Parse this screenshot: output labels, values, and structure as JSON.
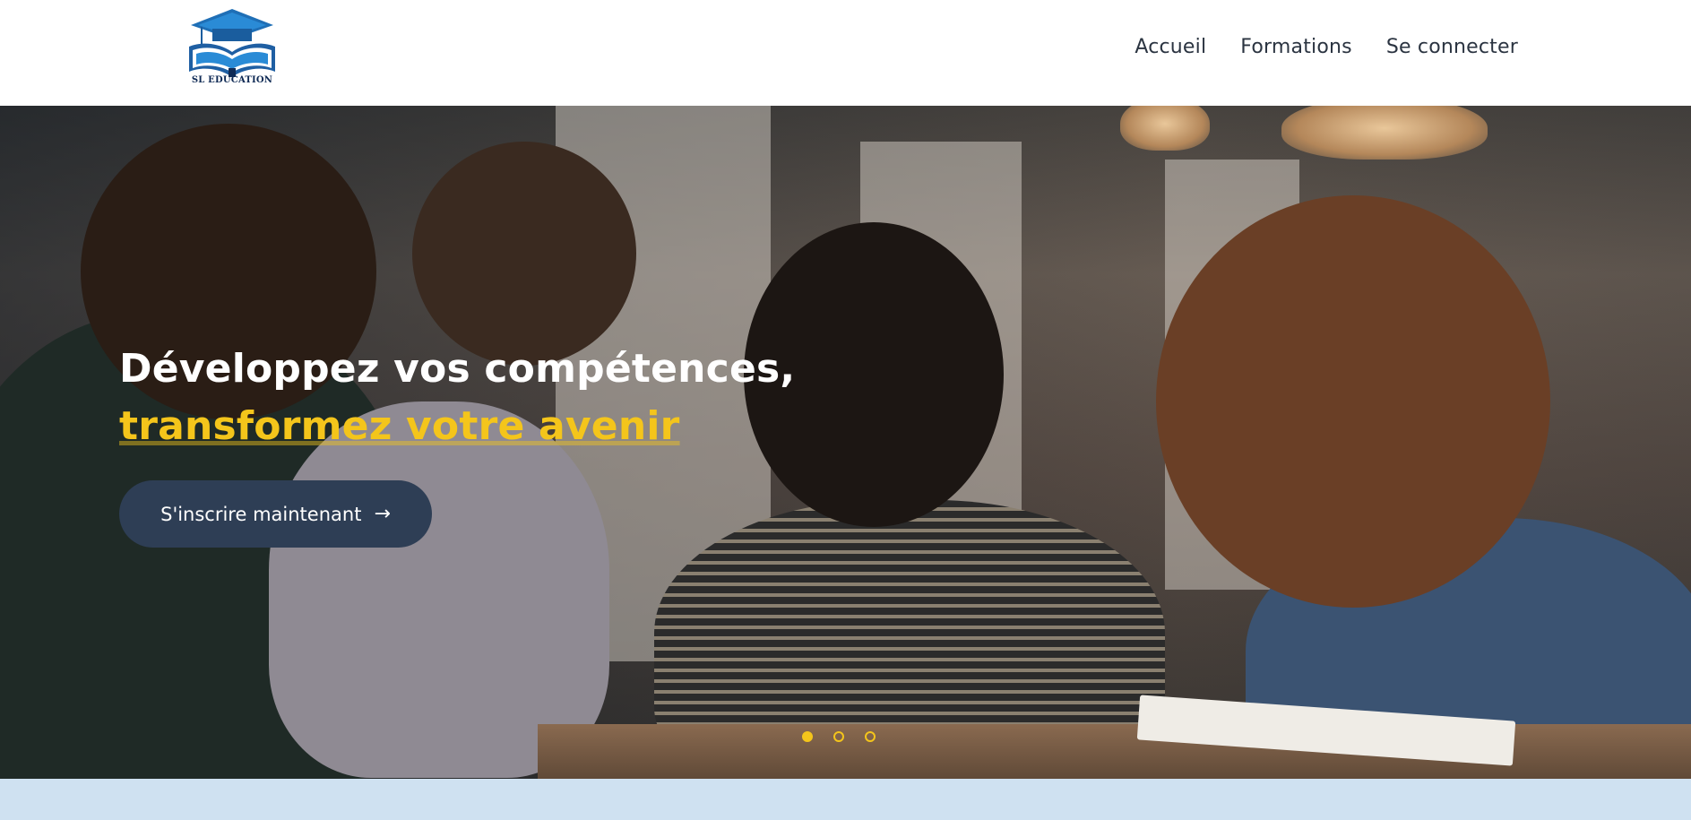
{
  "header": {
    "logo_text": "SL EDUCATION",
    "nav": [
      {
        "label": "Accueil"
      },
      {
        "label": "Formations"
      },
      {
        "label": "Se connecter"
      }
    ]
  },
  "hero": {
    "title_line1": "Développez vos compétences,",
    "title_line2": "transformez votre avenir",
    "cta_label": "S'inscrire maintenant",
    "cta_icon": "arrow-right-icon",
    "slides_count": 3,
    "active_slide": 1
  },
  "colors": {
    "accent": "#f4c51b",
    "cta_bg": "#2e3e55",
    "nav_text": "#2b3441",
    "bottom_band": "#cfe1f1"
  }
}
